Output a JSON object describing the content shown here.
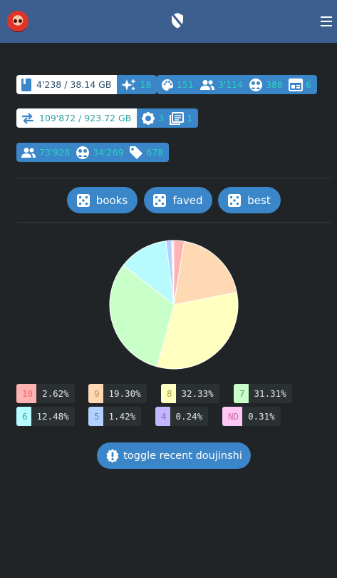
{
  "header": {
    "avatar_icon": "avatar-icon",
    "center_icon": "shield-icon",
    "menu_icon": "menu-icon"
  },
  "stats": {
    "library": {
      "icon": "book-icon",
      "value": "4'238 / 38.14 GB",
      "extra_icon": "sparkles-icon",
      "extra_value": "18"
    },
    "categories": [
      {
        "icon": "palette-icon",
        "value": "151"
      },
      {
        "icon": "users-icon",
        "value": "3'114"
      },
      {
        "icon": "circles-icon",
        "value": "388"
      },
      {
        "icon": "calendar-icon",
        "value": "6"
      }
    ],
    "transfer": {
      "icon": "exchange-icon",
      "value": "109'872 / 923.72 GB",
      "settings_icon": "gear-icon",
      "settings_value": "3",
      "queue_icon": "library-icon",
      "queue_value": "1"
    },
    "community": [
      {
        "icon": "users-icon",
        "value": "73'928"
      },
      {
        "icon": "circles-icon",
        "value": "34'269"
      },
      {
        "icon": "tag-icon",
        "value": "678"
      }
    ]
  },
  "random_buttons": [
    {
      "label": "books",
      "icon": "dice-icon"
    },
    {
      "label": "faved",
      "icon": "dice-icon"
    },
    {
      "label": "best",
      "icon": "dice-icon"
    }
  ],
  "chart_data": {
    "type": "pie",
    "slices": [
      {
        "label": "10",
        "value": 2.62,
        "percent": "2.62%",
        "color": "#ffb3b3"
      },
      {
        "label": "9",
        "value": 19.3,
        "percent": "19.30%",
        "color": "#ffd9b3"
      },
      {
        "label": "8",
        "value": 32.33,
        "percent": "32.33%",
        "color": "#ffffbf"
      },
      {
        "label": "7",
        "value": 31.31,
        "percent": "31.31%",
        "color": "#c9ffc9"
      },
      {
        "label": "6",
        "value": 12.48,
        "percent": "12.48%",
        "color": "#b7fbff"
      },
      {
        "label": "5",
        "value": 1.42,
        "percent": "1.42%",
        "color": "#b3d1ff"
      },
      {
        "label": "4",
        "value": 0.24,
        "percent": "0.24%",
        "color": "#c3b6ff"
      },
      {
        "label": "ND",
        "value": 0.31,
        "percent": "0.31%",
        "color": "#ffc8f4"
      }
    ]
  },
  "toggle": {
    "label": "toggle recent doujinshi",
    "icon": "exclamation-icon"
  }
}
